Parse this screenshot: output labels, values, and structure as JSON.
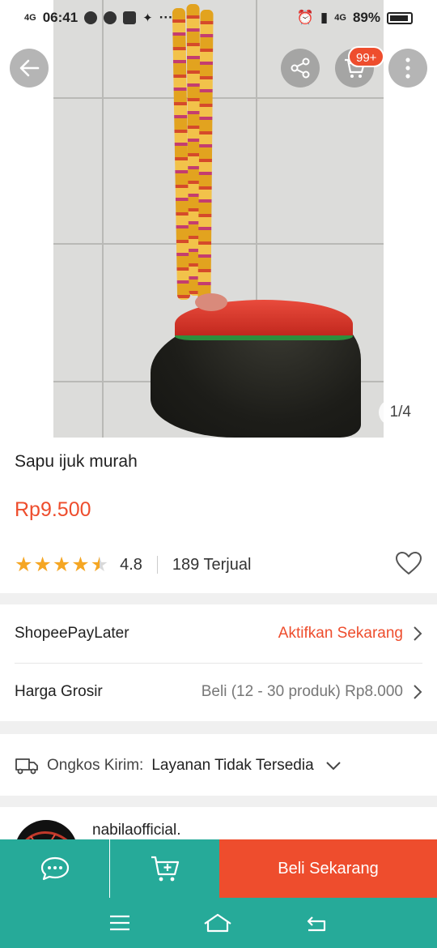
{
  "status_bar": {
    "network_left": "4G",
    "time": "06:41",
    "more": "···",
    "network_right": "4G",
    "battery": "89%"
  },
  "gallery": {
    "counter": "1/4"
  },
  "cart": {
    "badge": "99+"
  },
  "product": {
    "title": "Sapu ijuk murah",
    "price": "Rp9.500",
    "rating": "4.8",
    "stars": 4.5,
    "sold": "189 Terjual"
  },
  "paylater": {
    "label": "ShopeePayLater",
    "action": "Aktifkan Sekarang"
  },
  "wholesale": {
    "label": "Harga Grosir",
    "value": "Beli (12 - 30 produk) Rp8.000"
  },
  "shipping": {
    "label": "Ongkos Kirim:",
    "value": "Layanan Tidak Tersedia"
  },
  "shop": {
    "name": "nabilaofficial."
  },
  "actions": {
    "buy": "Beli Sekarang"
  },
  "colors": {
    "accent": "#ee4d2d",
    "teal": "#26aa99",
    "star": "#f5a623"
  },
  "icons": [
    "back-arrow-icon",
    "share-icon",
    "cart-icon",
    "more-vertical-icon",
    "heart-icon",
    "chevron-right-icon",
    "truck-icon",
    "chevron-down-icon",
    "chat-icon",
    "add-to-cart-icon",
    "menu-icon",
    "home-icon",
    "back-nav-icon"
  ]
}
